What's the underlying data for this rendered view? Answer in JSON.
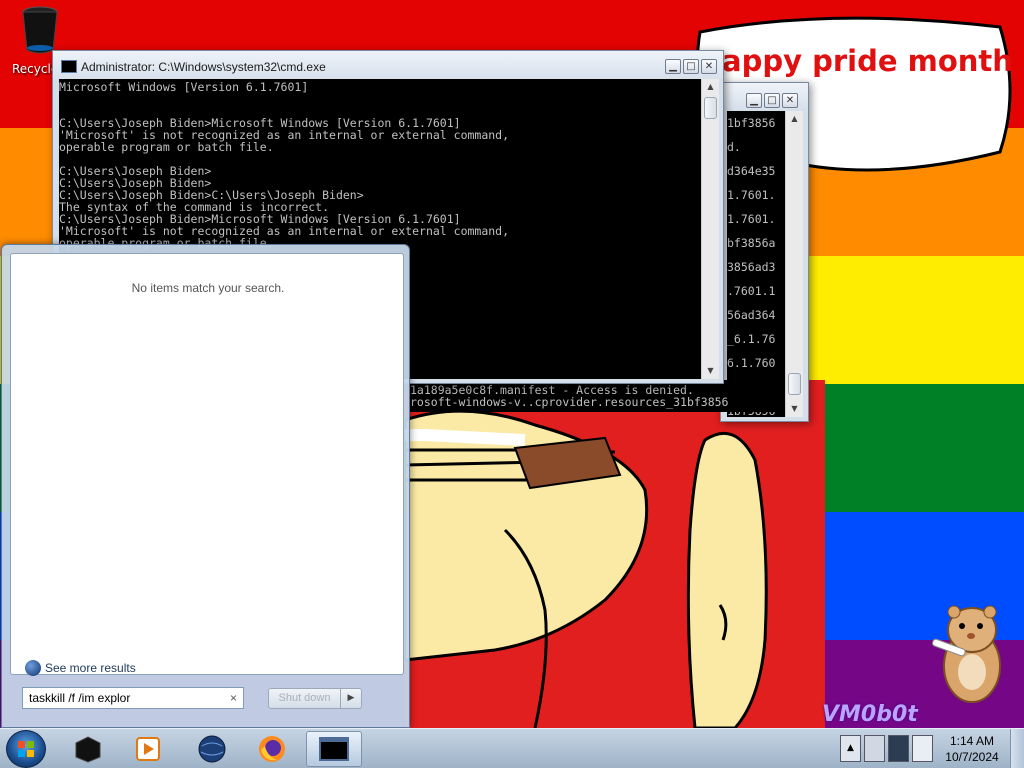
{
  "desktop": {
    "recycle_bin_label": "Recycle",
    "bubble_text": "appy pride month\nne!",
    "watermark": "VM0b0t"
  },
  "cmd_window": {
    "title": "Administrator: C:\\Windows\\system32\\cmd.exe",
    "lines": [
      "Microsoft Windows [Version 6.1.7601]",
      "",
      "",
      "C:\\Users\\Joseph Biden>Microsoft Windows [Version 6.1.7601]",
      "'Microsoft' is not recognized as an internal or external command,",
      "operable program or batch file.",
      "",
      "C:\\Users\\Joseph Biden>",
      "C:\\Users\\Joseph Biden>",
      "C:\\Users\\Joseph Biden>C:\\Users\\Joseph Biden>",
      "The syntax of the command is incorrect.",
      "C:\\Users\\Joseph Biden>Microsoft Windows [Version 6.1.7601]",
      "'Microsoft' is not recognized as an internal or external command,",
      "operable program or batch file."
    ]
  },
  "back_window": {
    "right_lines": [
      "1bf3856",
      "d.",
      "d364e35",
      "1.7601.",
      "1.7601.",
      "bf3856a",
      "3856ad3",
      ".7601.1",
      "56ad364",
      "_6.1.76",
      "6.1.760",
      "56ad364",
      "1bf3856"
    ],
    "bottom_lines": [
      "1a189a5e0c8f.manifest - Access is denied.",
      "rosoft-windows-v..cprovider.resources_31bf3856"
    ]
  },
  "start_menu": {
    "no_items_text": "No items match your search.",
    "see_more_label": "See more results",
    "search_value": "taskkill /f /im explor",
    "clear_label": "×",
    "shutdown_label": "Shut down",
    "shutdown_arrow": "▶"
  },
  "taskbar": {
    "time": "1:14 AM",
    "date": "10/7/2024"
  },
  "colors": {
    "flag": [
      "#e40303",
      "#ff8c00",
      "#ffed00",
      "#008026",
      "#004dff",
      "#750787"
    ]
  }
}
